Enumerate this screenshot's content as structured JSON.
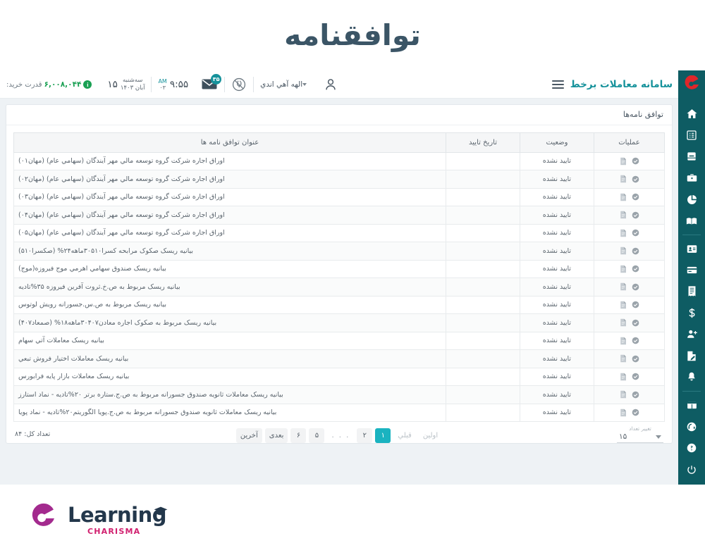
{
  "page": {
    "title": "توافقنامه",
    "title_color": "#3b5566"
  },
  "header": {
    "brand_text": "سامانه معاملات برخط",
    "brand_color": "#16929b",
    "menu_icon": "hamburger-icon",
    "logo_icon": "charisma-c-logo",
    "purchase_power_label": "قدرت خرید:",
    "purchase_power_value": "۶,۰۰۸,۰۴۴",
    "purchase_power_color": "#1aa053",
    "info_badge": "i",
    "date_day_name": "سه‌شنبه",
    "date_day_number": "۱۵",
    "date_month": "آبان ۱۴۰۳",
    "date_month_short": "۰۳",
    "time": "۹:۵۵",
    "time_ampm_top": "AM",
    "time_ampm_bottom": "۰۳",
    "mail_icon": "envelope-icon",
    "mail_badge_count": "۳۵",
    "mail_badge_color": "#16929b",
    "plug_icon": "plug-disconnected-icon",
    "user_name": "الهه آهي اندي",
    "user_caret": "chevron-down-icon",
    "avatar_icon": "user-avatar-icon"
  },
  "sidebar": {
    "background": "#0e5c63",
    "items": [
      {
        "icon": "home-icon"
      },
      {
        "icon": "list-icon"
      },
      {
        "icon": "book-icon"
      },
      {
        "icon": "briefcase-icon"
      },
      {
        "icon": "pie-chart-icon"
      },
      {
        "icon": "open-book-icon"
      },
      {
        "icon": "id-card-icon"
      },
      {
        "icon": "credit-card-icon"
      },
      {
        "icon": "receipt-icon"
      },
      {
        "icon": "dollar-icon"
      },
      {
        "icon": "user-plus-icon"
      },
      {
        "icon": "edit-document-icon"
      },
      {
        "icon": "bell-icon"
      },
      {
        "icon": "grid-icon"
      }
    ],
    "bottom_items": [
      {
        "icon": "headset-support-icon"
      },
      {
        "icon": "help-question-icon"
      },
      {
        "icon": "power-off-icon"
      }
    ]
  },
  "card": {
    "heading": "توافق نامه‌ها"
  },
  "table": {
    "columns": [
      {
        "key": "ops",
        "label": "عملیات"
      },
      {
        "key": "status",
        "label": "وضعیت"
      },
      {
        "key": "date",
        "label": "تاریخ تایید"
      },
      {
        "key": "title",
        "label": "عنوان توافق نامه ها"
      }
    ],
    "row_icons": [
      "check-circle-icon",
      "document-icon"
    ],
    "rows": [
      {
        "title": "اوراق اجاره شرکت گروه توسعه مالي مهر آيندگان (سهامي عام) (مهان۰۱)",
        "date": "",
        "status": "تایید نشده"
      },
      {
        "title": "اوراق اجاره شرکت گروه توسعه مالي مهر آيندگان (سهامي عام) (مهان۰۲)",
        "date": "",
        "status": "تایید نشده"
      },
      {
        "title": "اوراق اجاره شرکت گروه توسعه مالي مهر آيندگان (سهامي عام) (مهان۰۳)",
        "date": "",
        "status": "تایید نشده"
      },
      {
        "title": "اوراق اجاره شرکت گروه توسعه مالي مهر آيندگان (سهامي عام) (مهان۰۴)",
        "date": "",
        "status": "تایید نشده"
      },
      {
        "title": "اوراق اجاره شرکت گروه توسعه مالي مهر آيندگان (سهامي عام) (مهان۰۵)",
        "date": "",
        "status": "تایید نشده"
      },
      {
        "title": "بيانيه ريسک صکوک مرابحه کسرا۳۰۵۱۰ماهه۲۴% (صکسرا۵۱۰)",
        "date": "",
        "status": "تایید نشده"
      },
      {
        "title": "بيانيه ريسک صندوق سهامي اهرمي موج فيروزه(موج)",
        "date": "",
        "status": "تایید نشده"
      },
      {
        "title": "بيانيه ريسک مربوط به ص.خ.ثروت آفرين فيروزه ۳۵%تاديه",
        "date": "",
        "status": "تایید نشده"
      },
      {
        "title": "بيانيه ريسک مربوط به ص.س.جسورانه رويش لوتوس",
        "date": "",
        "status": "تایید نشده"
      },
      {
        "title": "بيانيه ريسک مربوط به صکوک اجاره معادن۳۰۴۰۷ماهه۱۸% (صمعاد۴۰۷)",
        "date": "",
        "status": "تایید نشده"
      },
      {
        "title": "بيانيه ريسک معاملات آتي سهام",
        "date": "",
        "status": "تایید نشده"
      },
      {
        "title": "بيانيه ريسک معاملات اختيار فروش تبعي",
        "date": "",
        "status": "تایید نشده"
      },
      {
        "title": "بيانيه ريسک معاملات بازار پايه فرابورس",
        "date": "",
        "status": "تایید نشده"
      },
      {
        "title": "بيانيه ريسک معاملات ثانويه صندوق جسورانه مربوط به ص.ج.ستاره برتر ۲۰%تاديه - نماد استارز",
        "date": "",
        "status": "تایید نشده"
      },
      {
        "title": "بيانيه ريسک معاملات ثانويه صندوق جسورانه مربوط به ص.ج.پويا الگوريتم۲۰%تاديه - نماد پويا",
        "date": "",
        "status": "تایید نشده"
      }
    ]
  },
  "footer": {
    "total_label": "تعداد کل: ۸۴",
    "pagination": [
      {
        "label": "اولین",
        "state": "muted"
      },
      {
        "label": "قبلي",
        "state": "muted"
      },
      {
        "label": "۱",
        "state": "active"
      },
      {
        "label": "۲",
        "state": "normal"
      },
      {
        "label": ". . .",
        "state": "dots"
      },
      {
        "label": "۵",
        "state": "normal"
      },
      {
        "label": "۶",
        "state": "normal"
      },
      {
        "label": "بعدی",
        "state": "normal"
      },
      {
        "label": "آخرین",
        "state": "normal"
      }
    ],
    "active_page_color": "#1ab3c0",
    "rows_per_page_label": "تغییر تعداد",
    "rows_per_page_value": "۱۵",
    "rows_caret": "chevron-down-icon"
  },
  "brand_footer": {
    "word_main": "Learning",
    "word_sub": "CHARISMA",
    "main_color": "#23374b",
    "sub_color": "#d1206f",
    "mark_color": "#a32a8e",
    "cap_icon": "graduation-cap-icon"
  }
}
